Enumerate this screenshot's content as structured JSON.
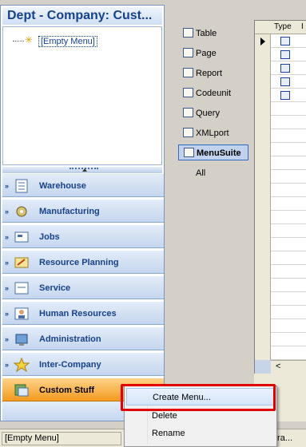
{
  "nav": {
    "title": "Dept - Company: Cust...",
    "tree_item": "[Empty Menu]",
    "buttons": [
      {
        "label": "Warehouse",
        "icon": "warehouse-icon",
        "active": false
      },
      {
        "label": "Manufacturing",
        "icon": "manufacturing-icon",
        "active": false
      },
      {
        "label": "Jobs",
        "icon": "jobs-icon",
        "active": false
      },
      {
        "label": "Resource Planning",
        "icon": "resource-planning-icon",
        "active": false
      },
      {
        "label": "Service",
        "icon": "service-icon",
        "active": false
      },
      {
        "label": "Human Resources",
        "icon": "human-resources-icon",
        "active": false
      },
      {
        "label": "Administration",
        "icon": "administration-icon",
        "active": false
      },
      {
        "label": "Inter-Company",
        "icon": "inter-company-icon",
        "active": false
      },
      {
        "label": "Custom Stuff",
        "icon": "custom-stuff-icon",
        "active": true
      }
    ]
  },
  "object_types": [
    {
      "label": "Table",
      "icon": "table-icon"
    },
    {
      "label": "Page",
      "icon": "page-icon"
    },
    {
      "label": "Report",
      "icon": "report-icon"
    },
    {
      "label": "Codeunit",
      "icon": "codeunit-icon"
    },
    {
      "label": "Query",
      "icon": "query-icon"
    },
    {
      "label": "XMLport",
      "icon": "xmlport-icon"
    },
    {
      "label": "MenuSuite",
      "icon": "menusuite-icon",
      "selected": true
    },
    {
      "label": "All",
      "icon": ""
    }
  ],
  "grid": {
    "col_type": "Type",
    "col_i": "I",
    "scroll_left": "<"
  },
  "context_menu": {
    "items": [
      "Create Menu...",
      "Delete",
      "Rename"
    ],
    "highlighted": "Create Menu..."
  },
  "status": {
    "left": "[Empty Menu]",
    "right": "\\ra..."
  },
  "colors": {
    "nav_title": "#15428b",
    "active_button": "#f39a1e",
    "highlight_box": "#e00000"
  }
}
